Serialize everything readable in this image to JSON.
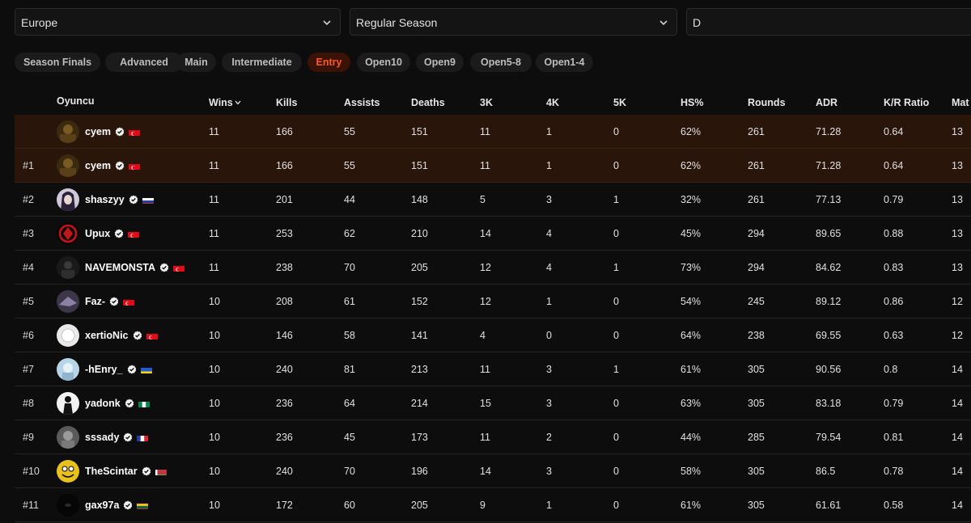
{
  "filters": {
    "region": "Europe",
    "season": "Regular Season",
    "division": "D"
  },
  "tabs": [
    {
      "label": "Season Finals"
    },
    {
      "label": "Advanced"
    },
    {
      "label": "Main"
    },
    {
      "label": "Intermediate"
    },
    {
      "label": "Entry",
      "active": true
    },
    {
      "label": "Open10"
    },
    {
      "label": "Open9"
    },
    {
      "label": "Open5-8"
    },
    {
      "label": "Open1-4"
    }
  ],
  "columns": {
    "player": "Oyuncu",
    "wins": "Wins",
    "kills": "Kills",
    "assists": "Assists",
    "deaths": "Deaths",
    "k3": "3K",
    "k4": "4K",
    "k5": "5K",
    "hs": "HS%",
    "rounds": "Rounds",
    "adr": "ADR",
    "kr": "K/R Ratio",
    "matches": "Mat"
  },
  "colors": {
    "accent": "#ff5a1f",
    "highlight_row": "#2a150a"
  },
  "rows": [
    {
      "rank": "",
      "name": "cyem",
      "flag": "turkey",
      "avatar": "dark-gold",
      "wins": "11",
      "kills": "166",
      "assists": "55",
      "deaths": "151",
      "k3": "11",
      "k4": "1",
      "k5": "0",
      "hs": "62%",
      "rounds": "261",
      "adr": "71.28",
      "kr": "0.64",
      "matches": "13",
      "highlight": true
    },
    {
      "rank": "#1",
      "name": "cyem",
      "flag": "turkey",
      "avatar": "dark-gold",
      "wins": "11",
      "kills": "166",
      "assists": "55",
      "deaths": "151",
      "k3": "11",
      "k4": "1",
      "k5": "0",
      "hs": "62%",
      "rounds": "261",
      "adr": "71.28",
      "kr": "0.64",
      "matches": "13",
      "highlight": true
    },
    {
      "rank": "#2",
      "name": "shaszyy",
      "flag": "russia",
      "avatar": "anime",
      "wins": "11",
      "kills": "201",
      "assists": "44",
      "deaths": "148",
      "k3": "5",
      "k4": "3",
      "k5": "1",
      "hs": "32%",
      "rounds": "261",
      "adr": "77.13",
      "kr": "0.79",
      "matches": "13"
    },
    {
      "rank": "#3",
      "name": "Upux",
      "flag": "turkey",
      "avatar": "red-emblem",
      "wins": "11",
      "kills": "253",
      "assists": "62",
      "deaths": "210",
      "k3": "14",
      "k4": "4",
      "k5": "0",
      "hs": "45%",
      "rounds": "294",
      "adr": "89.65",
      "kr": "0.88",
      "matches": "13"
    },
    {
      "rank": "#4",
      "name": "NAVEMONSTA",
      "flag": "turkey",
      "avatar": "dark",
      "wins": "11",
      "kills": "238",
      "assists": "70",
      "deaths": "205",
      "k3": "12",
      "k4": "4",
      "k5": "1",
      "hs": "73%",
      "rounds": "294",
      "adr": "84.62",
      "kr": "0.83",
      "matches": "13"
    },
    {
      "rank": "#5",
      "name": "Faz-",
      "flag": "turkey",
      "avatar": "purple",
      "wins": "10",
      "kills": "208",
      "assists": "61",
      "deaths": "152",
      "k3": "12",
      "k4": "1",
      "k5": "0",
      "hs": "54%",
      "rounds": "245",
      "adr": "89.12",
      "kr": "0.86",
      "matches": "12"
    },
    {
      "rank": "#6",
      "name": "xertioNic",
      "flag": "turkey",
      "avatar": "white",
      "wins": "10",
      "kills": "146",
      "assists": "58",
      "deaths": "141",
      "k3": "4",
      "k4": "0",
      "k5": "0",
      "hs": "64%",
      "rounds": "238",
      "adr": "69.55",
      "kr": "0.63",
      "matches": "12"
    },
    {
      "rank": "#7",
      "name": "-hEnry_",
      "flag": "ukraine",
      "avatar": "light-blue",
      "wins": "10",
      "kills": "240",
      "assists": "81",
      "deaths": "213",
      "k3": "11",
      "k4": "3",
      "k5": "1",
      "hs": "61%",
      "rounds": "305",
      "adr": "90.56",
      "kr": "0.8",
      "matches": "14"
    },
    {
      "rank": "#8",
      "name": "yadonk",
      "flag": "nigeria",
      "avatar": "bw-figure",
      "wins": "10",
      "kills": "236",
      "assists": "64",
      "deaths": "214",
      "k3": "15",
      "k4": "3",
      "k5": "0",
      "hs": "63%",
      "rounds": "305",
      "adr": "83.18",
      "kr": "0.79",
      "matches": "14"
    },
    {
      "rank": "#9",
      "name": "sssady",
      "flag": "france",
      "avatar": "grey",
      "wins": "10",
      "kills": "236",
      "assists": "45",
      "deaths": "173",
      "k3": "11",
      "k4": "2",
      "k5": "0",
      "hs": "44%",
      "rounds": "285",
      "adr": "79.54",
      "kr": "0.81",
      "matches": "14"
    },
    {
      "rank": "#10",
      "name": "TheScintar",
      "flag": "belarus",
      "avatar": "yellow-face",
      "wins": "10",
      "kills": "240",
      "assists": "70",
      "deaths": "196",
      "k3": "14",
      "k4": "3",
      "k5": "0",
      "hs": "58%",
      "rounds": "305",
      "adr": "86.5",
      "kr": "0.78",
      "matches": "14"
    },
    {
      "rank": "#11",
      "name": "gax97a",
      "flag": "lithuania",
      "avatar": "black",
      "wins": "10",
      "kills": "172",
      "assists": "60",
      "deaths": "205",
      "k3": "9",
      "k4": "1",
      "k5": "0",
      "hs": "61%",
      "rounds": "305",
      "adr": "61.61",
      "kr": "0.58",
      "matches": "14"
    }
  ]
}
